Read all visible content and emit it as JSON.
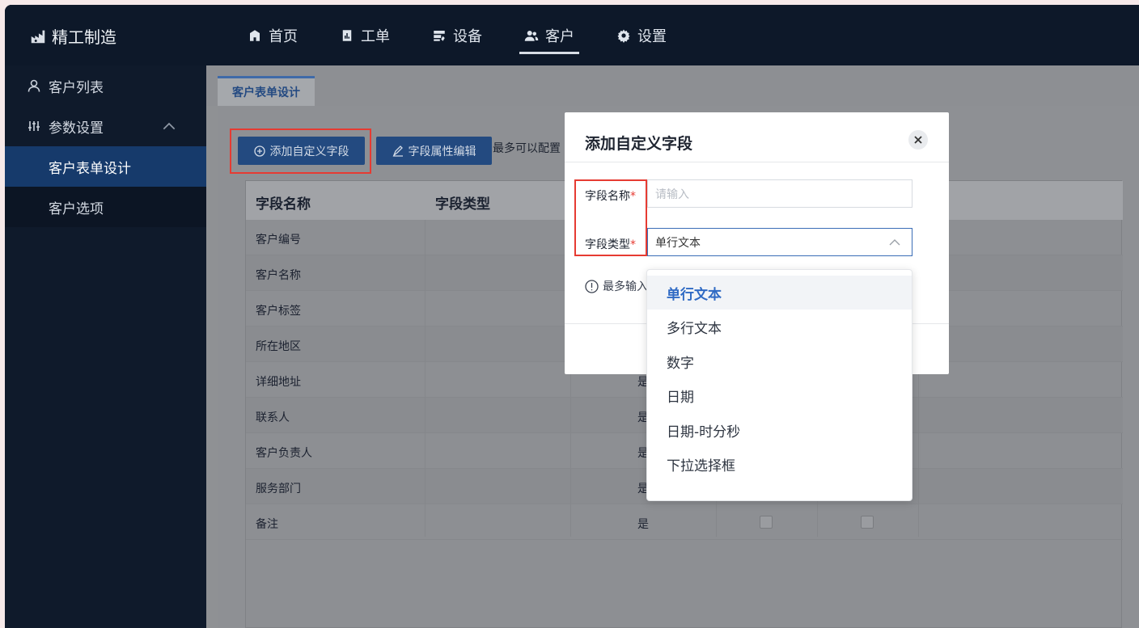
{
  "brand": {
    "name": "精工制造"
  },
  "nav": [
    {
      "label": "首页",
      "icon": "building-icon"
    },
    {
      "label": "工单",
      "icon": "document-chart-icon"
    },
    {
      "label": "设备",
      "icon": "server-icon"
    },
    {
      "label": "客户",
      "icon": "users-icon",
      "active": true
    },
    {
      "label": "设置",
      "icon": "gear-icon"
    }
  ],
  "sidebar": {
    "items": [
      {
        "label": "客户列表"
      },
      {
        "label": "参数设置"
      },
      {
        "label": "客户表单设计"
      },
      {
        "label": "客户选项"
      }
    ]
  },
  "tab": {
    "label": "客户表单设计"
  },
  "toolbar": {
    "add_label": "添加自定义字段",
    "edit_label": "字段属性编辑",
    "hint": "最多可以配置"
  },
  "table": {
    "headers": [
      "字段名称",
      "字段类型"
    ],
    "rows": [
      {
        "name": "客户编号",
        "req": ""
      },
      {
        "name": "客户名称",
        "req": ""
      },
      {
        "name": "客户标签",
        "req": ""
      },
      {
        "name": "所在地区",
        "req": ""
      },
      {
        "name": "详细地址",
        "req": "是"
      },
      {
        "name": "联系人",
        "req": "是"
      },
      {
        "name": "客户负责人",
        "req": "是"
      },
      {
        "name": "服务部门",
        "req": "是"
      },
      {
        "name": "备注",
        "req": "是"
      }
    ]
  },
  "modal": {
    "title": "添加自定义字段",
    "name_label": "字段名称",
    "type_label": "字段类型",
    "required_mark": "*",
    "name_placeholder": "请输入",
    "type_value": "单行文本",
    "info_text": "最多输入"
  },
  "dropdown": {
    "options": [
      "单行文本",
      "多行文本",
      "数字",
      "日期",
      "日期-时分秒",
      "下拉选择框"
    ],
    "selected": "单行文本"
  },
  "colors": {
    "accent": "#2f6ac4",
    "required": "#e63b32",
    "highlight_box": "#e63b32"
  }
}
